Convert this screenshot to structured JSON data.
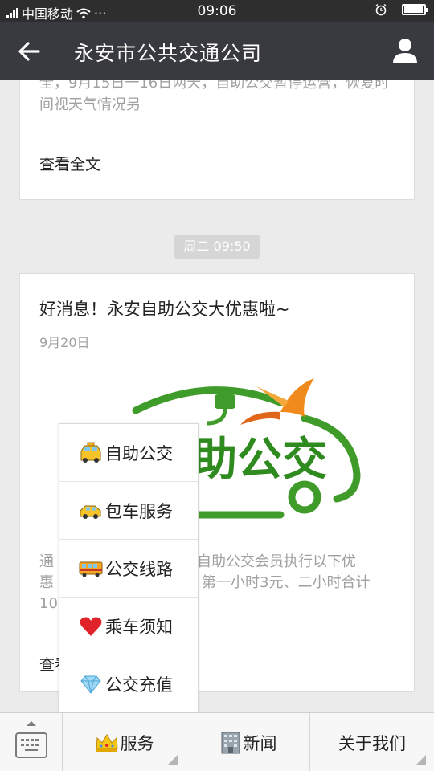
{
  "status_bar": {
    "carrier": "中国移动",
    "dots": "···",
    "time": "09:06",
    "battery_level": 0.9
  },
  "title_bar": {
    "title": "永安市公共交通公司"
  },
  "messages": [
    {
      "summary": "全，9月15日一16日两天，自助公交暂停运营，恢复时间视天气情况另",
      "read_more": "查看全文"
    },
    {
      "time_chip": "周二 09:50",
      "title": "好消息！永安自助公交大优惠啦~",
      "date": "9月20日",
      "cover_text": "助公交",
      "summary_line1_a": "通",
      "summary_line1_b": "自助公交会员执行以下优",
      "summary_line2_a": "惠",
      "summary_line2_b": "第一小时3元、二小时合计",
      "summary_line3_a": "10",
      "read_more": "查看全文"
    }
  ],
  "popup_menu": {
    "items": [
      {
        "label": "自助公交",
        "icon": "taxi-icon"
      },
      {
        "label": "包车服务",
        "icon": "car-icon"
      },
      {
        "label": "公交线路",
        "icon": "bus-icon"
      },
      {
        "label": "乘车须知",
        "icon": "heart-icon"
      },
      {
        "label": "公交充值",
        "icon": "diamond-icon"
      }
    ]
  },
  "bottom_menu": {
    "tabs": [
      {
        "label": "服务",
        "icon": "crown-icon"
      },
      {
        "label": "新闻",
        "icon": "building-icon"
      },
      {
        "label": "关于我们"
      }
    ]
  },
  "colors": {
    "title_bar": "#393a3f",
    "status_bar": "#2e2e2e",
    "logo_green": "#3f9c2a",
    "logo_orange": "#f08a1c"
  }
}
